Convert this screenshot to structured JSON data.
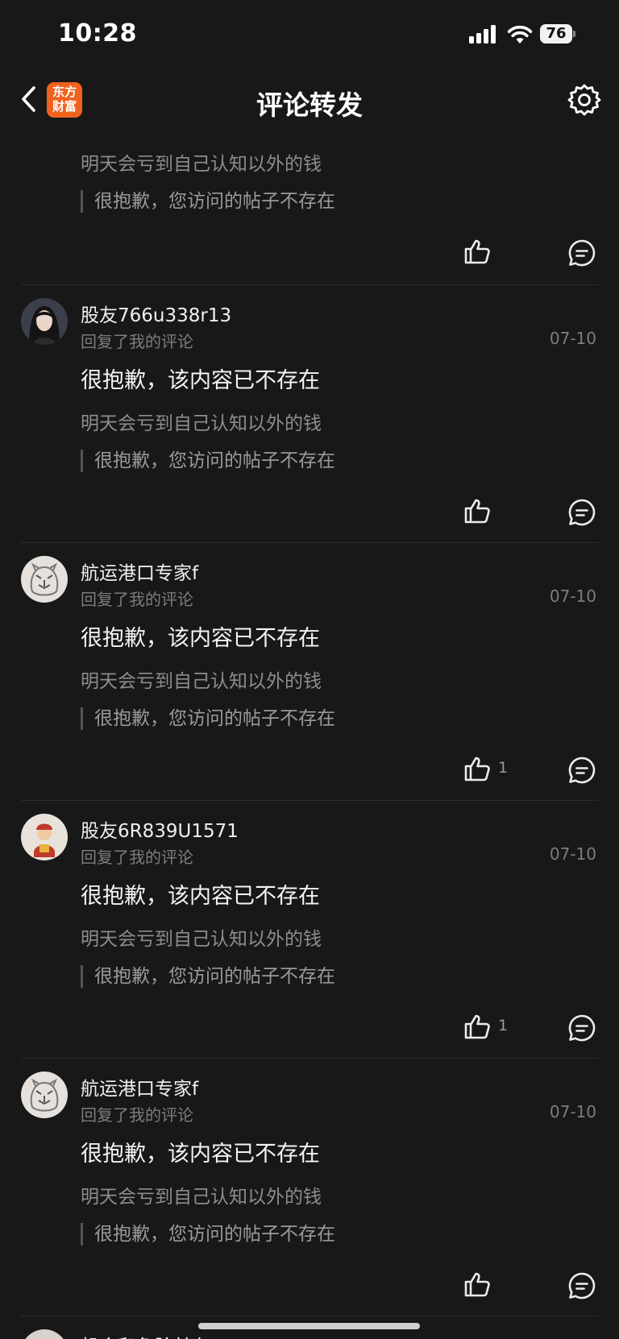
{
  "status_bar": {
    "time": "10:28",
    "battery": "76"
  },
  "nav": {
    "logo_line1": "东方",
    "logo_line2": "财富",
    "title": "评论转发"
  },
  "comments": [
    {
      "username": "",
      "reply_label": "",
      "date": "",
      "text": "",
      "quoted": "明天会亏到自己认知以外的钱",
      "post_ref": "很抱歉，您访问的帖子不存在",
      "likes": ""
    },
    {
      "username": "股友766u338r13",
      "reply_label": "回复了我的评论",
      "date": "07-10",
      "text": "很抱歉，该内容已不存在",
      "quoted": "明天会亏到自己认知以外的钱",
      "post_ref": "很抱歉，您访问的帖子不存在",
      "likes": ""
    },
    {
      "username": "航运港口专家f",
      "reply_label": "回复了我的评论",
      "date": "07-10",
      "text": "很抱歉，该内容已不存在",
      "quoted": "明天会亏到自己认知以外的钱",
      "post_ref": "很抱歉，您访问的帖子不存在",
      "likes": "1"
    },
    {
      "username": "股友6R839U1571",
      "reply_label": "回复了我的评论",
      "date": "07-10",
      "text": "很抱歉，该内容已不存在",
      "quoted": "明天会亏到自己认知以外的钱",
      "post_ref": "很抱歉，您访问的帖子不存在",
      "likes": "1"
    },
    {
      "username": "航运港口专家f",
      "reply_label": "回复了我的评论",
      "date": "07-10",
      "text": "很抱歉，该内容已不存在",
      "quoted": "明天会亏到自己认知以外的钱",
      "post_ref": "很抱歉，您访问的帖子不存在",
      "likes": ""
    },
    {
      "username": "机会和危险并存",
      "reply_label": "",
      "date": "",
      "text": "",
      "quoted": "",
      "post_ref": "",
      "likes": ""
    }
  ],
  "icons": {
    "back": "chevron-left-icon",
    "settings": "gear-icon",
    "like": "thumbs-up-icon",
    "reply": "chat-bubble-icon",
    "signal": "cellular-signal-icon",
    "wifi": "wifi-icon",
    "battery": "battery-icon"
  },
  "colors": {
    "background": "#181818",
    "logo": "#f0621f",
    "text_primary": "#f4f4f4",
    "text_secondary": "#7d7d7d"
  }
}
